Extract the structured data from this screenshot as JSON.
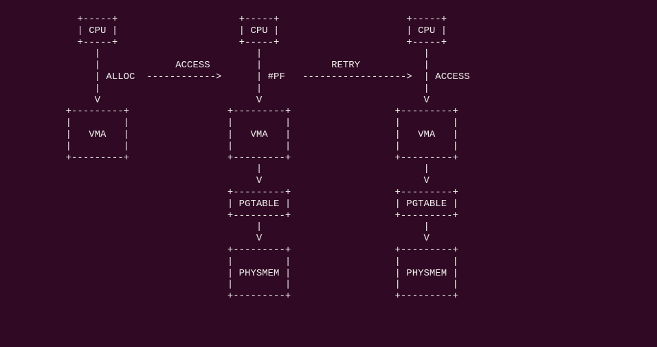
{
  "diagram": {
    "type": "ascii-flow",
    "columns": [
      {
        "id": "col1",
        "boxes": [
          {
            "label": "CPU",
            "type": "small"
          },
          {
            "label": "VMA",
            "type": "wide"
          }
        ],
        "arrow_label": "ALLOC"
      },
      {
        "id": "col2",
        "boxes": [
          {
            "label": "CPU",
            "type": "small"
          },
          {
            "label": "VMA",
            "type": "wide"
          },
          {
            "label": "PGTABLE",
            "type": "wide"
          },
          {
            "label": "PHYSMEM",
            "type": "wide"
          }
        ],
        "arrow_label": "#PF"
      },
      {
        "id": "col3",
        "boxes": [
          {
            "label": "CPU",
            "type": "small"
          },
          {
            "label": "VMA",
            "type": "wide"
          },
          {
            "label": "PGTABLE",
            "type": "wide"
          },
          {
            "label": "PHYSMEM",
            "type": "wide"
          }
        ],
        "arrow_label": "ACCESS"
      }
    ],
    "transitions": [
      {
        "from": "col1",
        "to": "col2",
        "label": "ACCESS"
      },
      {
        "from": "col2",
        "to": "col3",
        "label": "RETRY"
      }
    ]
  },
  "labels": {
    "cpu": "CPU",
    "vma": "VMA",
    "pgtable": "PGTABLE",
    "physmem": "PHYSMEM",
    "alloc": "ALLOC",
    "pf": "#PF",
    "access": "ACCESS",
    "retry": "RETRY"
  },
  "ascii_lines": [
    "           +-----+                     +-----+                      +-----+",
    "           | CPU |                     | CPU |                      | CPU |",
    "           +-----+                     +-----+                      +-----+",
    "              |                           |                            |",
    "              |             ACCESS        |            RETRY           |",
    "              | ALLOC  ------------>      | #PF   ------------------>  | ACCESS",
    "              |                           |                            |",
    "              V                           V                            V",
    "         +---------+                 +---------+                  +---------+",
    "         |         |                 |         |                  |         |",
    "         |   VMA   |                 |   VMA   |                  |   VMA   |",
    "         |         |                 |         |                  |         |",
    "         +---------+                 +---------+                  +---------+",
    "                                          |                            |",
    "                                          V                            V",
    "                                     +---------+                  +---------+",
    "                                     | PGTABLE |                  | PGTABLE |",
    "                                     +---------+                  +---------+",
    "                                          |                            |",
    "                                          V                            V",
    "                                     +---------+                  +---------+",
    "                                     |         |                  |         |",
    "                                     | PHYSMEM |                  | PHYSMEM |",
    "                                     |         |                  |         |",
    "                                     +---------+                  +---------+"
  ]
}
